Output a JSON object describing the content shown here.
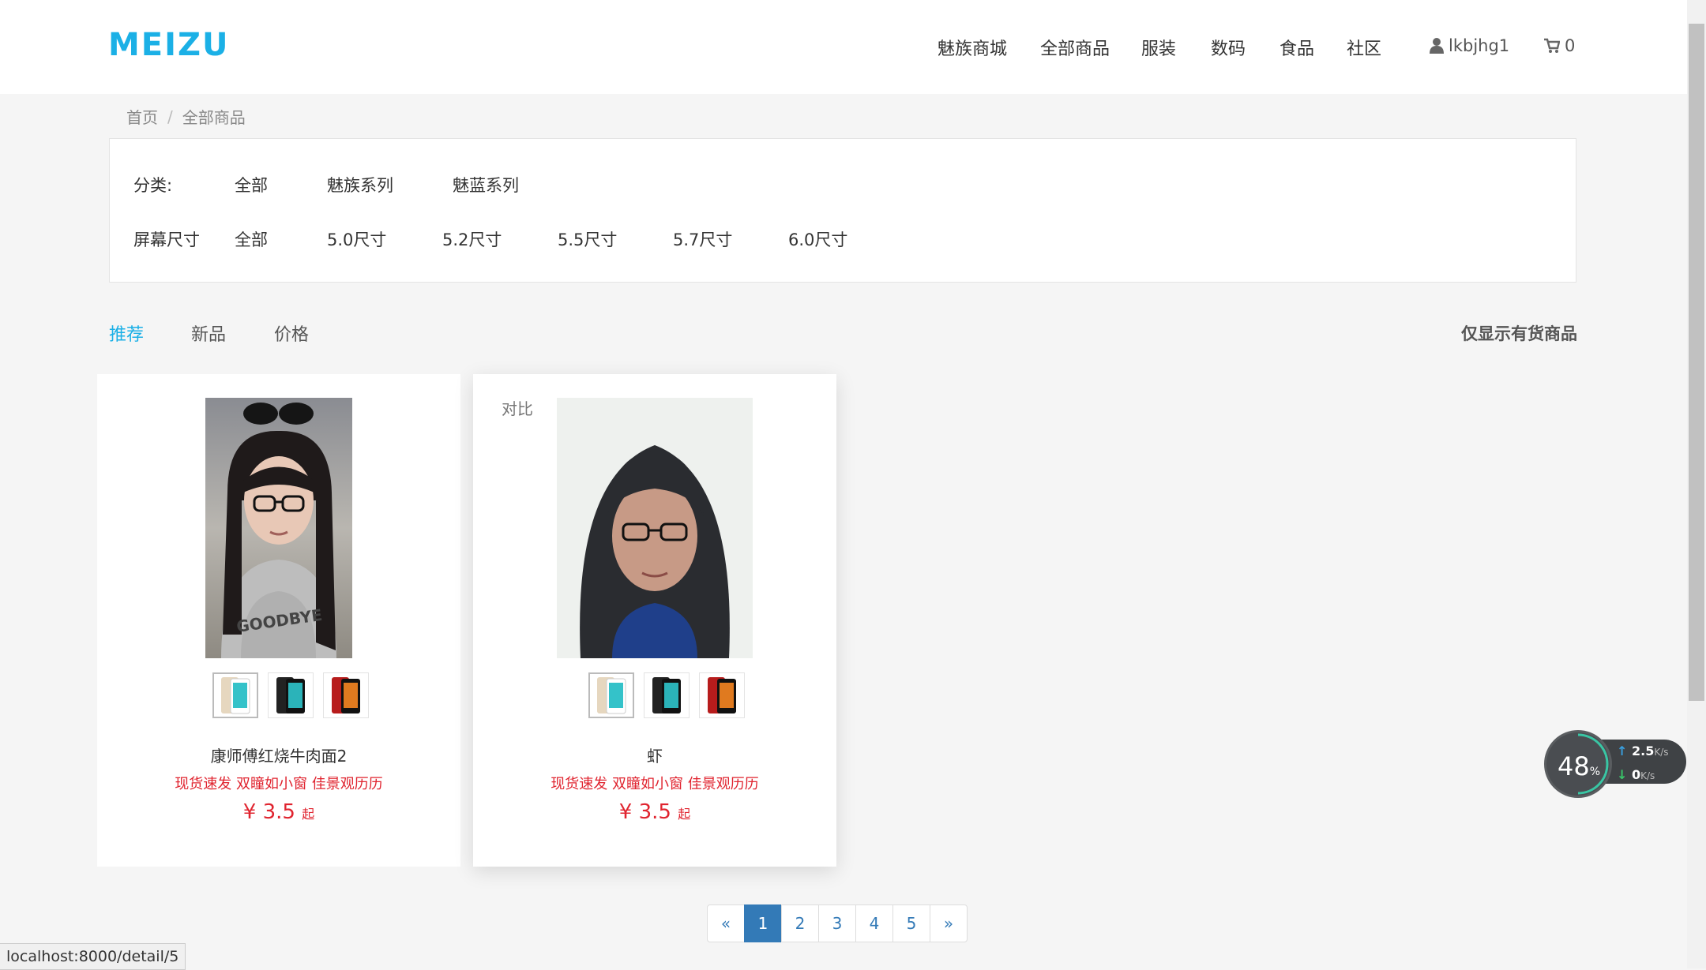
{
  "brand": "MEIZU",
  "nav": [
    "魅族商城",
    "全部商品",
    "服装",
    "数码",
    "食品",
    "社区"
  ],
  "user": {
    "name": "lkbjhg1"
  },
  "cart": {
    "count": "0"
  },
  "breadcrumb": {
    "home": "首页",
    "current": "全部商品",
    "separator": "/"
  },
  "filters": {
    "category": {
      "label": "分类:",
      "options": [
        "全部",
        "魅族系列",
        "魅蓝系列"
      ]
    },
    "screen": {
      "label": "屏幕尺寸",
      "options": [
        "全部",
        "5.0尺寸",
        "5.2尺寸",
        "5.5尺寸",
        "5.7尺寸",
        "6.0尺寸"
      ]
    }
  },
  "sort": {
    "tabs": [
      "推荐",
      "新品",
      "价格"
    ],
    "active": "推荐",
    "in_stock": "仅显示有货商品"
  },
  "products": [
    {
      "name": "康师傅红烧牛肉面2",
      "tagline": "现货速发 双瞳如小窗 佳景观历历",
      "price": "¥ 3.5",
      "suffix": "起",
      "compare": ""
    },
    {
      "name": "虾",
      "tagline": "现货速发 双瞳如小窗 佳景观历历",
      "price": "¥ 3.5",
      "suffix": "起",
      "compare": "对比"
    }
  ],
  "pagination": {
    "prev": "«",
    "pages": [
      "1",
      "2",
      "3",
      "4",
      "5"
    ],
    "active": "1",
    "next": "»"
  },
  "status_url": "localhost:8000/detail/5",
  "speed_widget": {
    "percent": "48",
    "percent_unit": "%",
    "up": "2.5",
    "up_unit": "K/s",
    "down": "0",
    "down_unit": "K/s"
  },
  "colors": {
    "accent": "#1bb0e6",
    "price": "#e0242f",
    "pager_active": "#337ab7"
  }
}
